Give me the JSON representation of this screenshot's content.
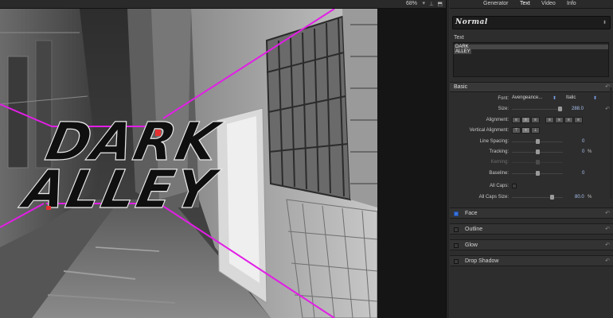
{
  "viewer": {
    "zoom": "68%",
    "zoom_caret": "▾",
    "title_line1": "DARK",
    "title_line2": "ALLEY"
  },
  "inspector": {
    "tabs": [
      {
        "label": "Generator",
        "active": false
      },
      {
        "label": "Text",
        "active": true
      },
      {
        "label": "Video",
        "active": false
      },
      {
        "label": "Info",
        "active": false
      }
    ],
    "preset": "Normal",
    "text_section_label": "Text",
    "text_content": [
      "DARK",
      "ALLEY"
    ],
    "basic": {
      "label": "Basic",
      "font_label": "Font:",
      "font_value": "Avengeance...",
      "font_style": "Italic",
      "size_label": "Size:",
      "size_value": "288.0",
      "alignment_label": "Alignment:",
      "vertical_alignment_label": "Vertical Alignment:",
      "line_spacing_label": "Line Spacing:",
      "line_spacing_value": "0",
      "tracking_label": "Tracking:",
      "tracking_value": "0",
      "tracking_unit": "%",
      "kerning_label": "Kerning:",
      "baseline_label": "Baseline:",
      "baseline_value": "0",
      "all_caps_label": "All Caps:",
      "all_caps_size_label": "All Caps Size:",
      "all_caps_size_value": "80.0",
      "all_caps_size_unit": "%"
    },
    "groups": [
      {
        "label": "Face",
        "enabled": true
      },
      {
        "label": "Outline",
        "enabled": false
      },
      {
        "label": "Glow",
        "enabled": false
      },
      {
        "label": "Drop Shadow",
        "enabled": false
      }
    ]
  },
  "colors": {
    "guide_lines": "#e21ee6",
    "accent_blue": "#3b74d8",
    "value_blue": "#a9c3f0"
  },
  "icons": [
    "reset-arrow-icon",
    "caret-icon",
    "checkbox-icon",
    "cursor-icon"
  ]
}
